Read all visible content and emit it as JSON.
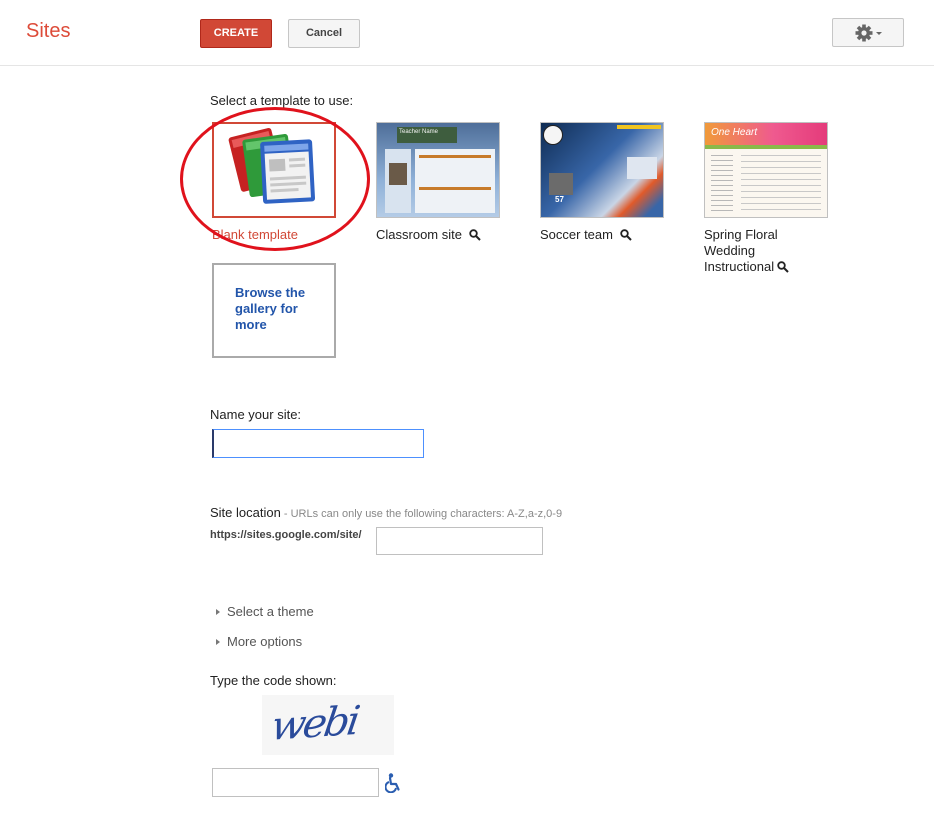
{
  "header": {
    "app_title": "Sites",
    "create_label": "CREATE",
    "cancel_label": "Cancel",
    "settings_icon": "gear-icon"
  },
  "templates": {
    "heading": "Select a template to use:",
    "items": [
      {
        "label": "Blank template",
        "selected": true
      },
      {
        "label": "Classroom site",
        "preview_icon": "magnifier-icon"
      },
      {
        "label": "Soccer team",
        "preview_icon": "magnifier-icon"
      },
      {
        "label": "Spring Floral Wedding Instructional",
        "label_line1": "Spring Floral",
        "label_line2": "Wedding",
        "label_line3": "Instructional",
        "preview_icon": "magnifier-icon"
      }
    ],
    "classroom_thumb_text": "Teacher Name",
    "soccer_thumb_score": "57",
    "wedding_thumb_text": "One Heart",
    "browse_label": "Browse the gallery for more",
    "browse_line1": "Browse the",
    "browse_line2": "gallery for",
    "browse_line3": "more"
  },
  "name": {
    "label": "Name your site:",
    "value": ""
  },
  "location": {
    "label": "Site location",
    "hint": " - URLs can only use the following characters: A-Z,a-z,0-9",
    "prefix": "https://sites.google.com/site/",
    "value": ""
  },
  "options": {
    "theme_label": "Select a theme",
    "more_label": "More options"
  },
  "captcha": {
    "label": "Type the code shown:",
    "code": "webi",
    "value": "",
    "accessibility_icon": "wheelchair-icon"
  },
  "colors": {
    "brand_red": "#dd4b39",
    "create_button": "#d14836",
    "link_blue": "#2255aa",
    "highlight_circle": "#e0121c"
  }
}
